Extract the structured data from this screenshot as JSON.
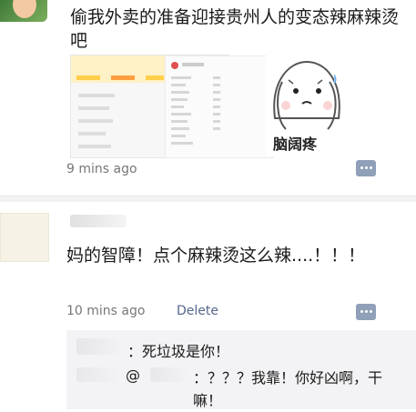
{
  "post1": {
    "text": "偷我外卖的准备迎接贵州人的变态辣麻辣烫吧",
    "time": "9 mins ago",
    "sticker_caption": "脑阔疼"
  },
  "post2": {
    "text": "妈的智障！点个麻辣烫这么辣....！！！",
    "time": "10 mins ago",
    "delete_label": "Delete"
  },
  "replies": [
    {
      "text": "：死垃圾是你！"
    },
    {
      "text": "：？？？我靠！你好凶啊，干嘛！"
    }
  ],
  "colors": {
    "link": "#55678f",
    "comment_button": "#8fa0b8"
  }
}
